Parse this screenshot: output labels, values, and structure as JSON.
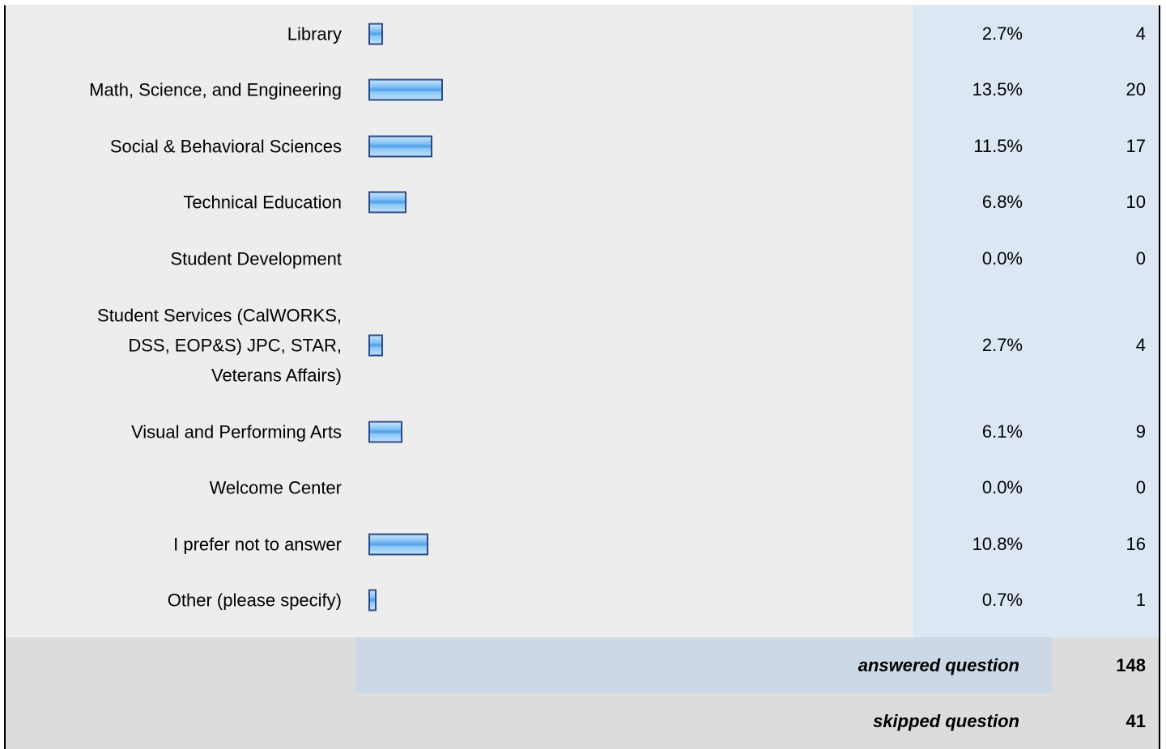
{
  "chart_data": {
    "type": "bar",
    "orientation": "horizontal",
    "categories": [
      "Library",
      "Math, Science, and Engineering",
      "Social & Behavioral Sciences",
      "Technical Education",
      "Student Development",
      "Student Services (CalWORKS,\nDSS, EOP&S) JPC, STAR,\nVeterans Affairs)",
      "Visual and Performing Arts",
      "Welcome Center",
      "I prefer not to answer",
      "Other (please specify)"
    ],
    "percent_labels": [
      "2.7%",
      "13.5%",
      "11.5%",
      "6.8%",
      "0.0%",
      "2.7%",
      "6.1%",
      "0.0%",
      "10.8%",
      "0.7%"
    ],
    "percent_values": [
      2.7,
      13.5,
      11.5,
      6.8,
      0.0,
      2.7,
      6.1,
      0.0,
      10.8,
      0.7
    ],
    "counts": [
      "4",
      "20",
      "17",
      "10",
      "0",
      "4",
      "9",
      "0",
      "16",
      "1"
    ],
    "xlim": [
      0,
      100
    ]
  },
  "summary": {
    "answered_label": "answered question",
    "answered_value": "148",
    "skipped_label": "skipped question",
    "skipped_value": "41"
  },
  "colors": {
    "bar_border": "#2d4a86",
    "bar_fill": "#7fc0f4",
    "percent_column_bg": "#dce7f4",
    "background": "#ededed"
  }
}
